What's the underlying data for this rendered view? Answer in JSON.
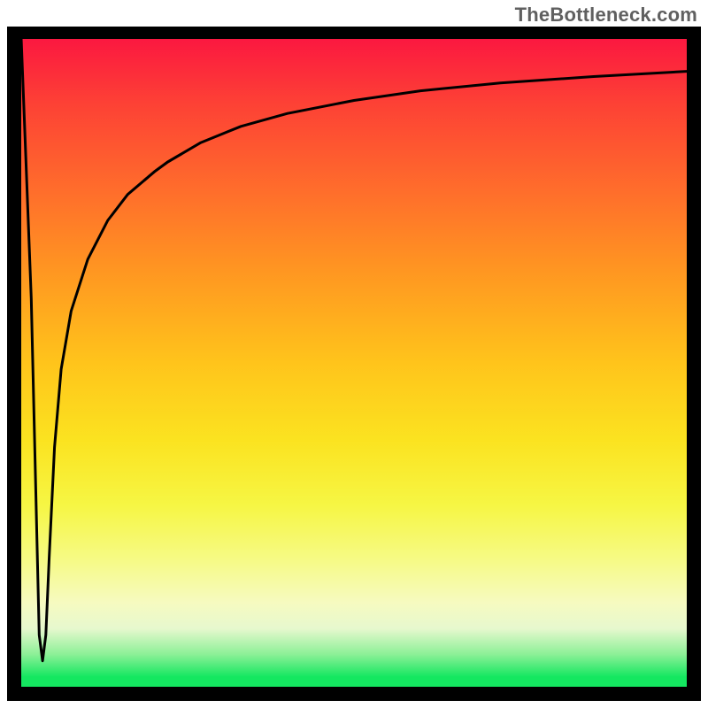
{
  "attribution": "TheBottleneck.com",
  "chart_data": {
    "type": "line",
    "title": "",
    "xlabel": "",
    "ylabel": "",
    "xlim": [
      0,
      100
    ],
    "ylim": [
      0,
      100
    ],
    "grid": false,
    "series": [
      {
        "name": "bottleneck-curve",
        "x": [
          0,
          1.5,
          2.7,
          3.2,
          3.7,
          4.2,
          5,
          6,
          7.5,
          10,
          13,
          16,
          20,
          22,
          27,
          33,
          40,
          50,
          60,
          72,
          86,
          100
        ],
        "y": [
          100,
          60,
          8,
          4,
          8,
          20,
          37,
          49,
          58,
          66,
          72,
          76,
          79.5,
          81,
          84,
          86.5,
          88.5,
          90.5,
          92,
          93.2,
          94.2,
          95
        ]
      }
    ],
    "highlight_segment": {
      "x_from": 18.5,
      "x_to": 24
    },
    "gradient_stops": [
      {
        "pos": 0,
        "color": "#fb1840"
      },
      {
        "pos": 0.1,
        "color": "#fd4135"
      },
      {
        "pos": 0.24,
        "color": "#ff6f2b"
      },
      {
        "pos": 0.36,
        "color": "#ff9721"
      },
      {
        "pos": 0.5,
        "color": "#ffc41b"
      },
      {
        "pos": 0.62,
        "color": "#fbe320"
      },
      {
        "pos": 0.72,
        "color": "#f6f644"
      },
      {
        "pos": 0.8,
        "color": "#f6fa82"
      },
      {
        "pos": 0.87,
        "color": "#f6fac0"
      },
      {
        "pos": 0.91,
        "color": "#e7f8ce"
      },
      {
        "pos": 0.95,
        "color": "#8cf097"
      },
      {
        "pos": 0.985,
        "color": "#14e760"
      },
      {
        "pos": 1.0,
        "color": "#14e760"
      }
    ]
  }
}
